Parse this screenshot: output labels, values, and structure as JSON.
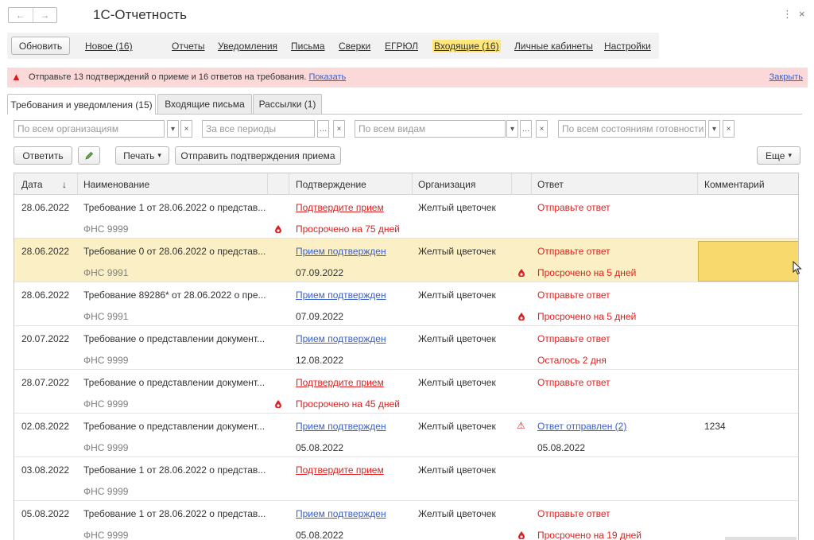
{
  "window": {
    "title": "1С-Отчетность",
    "nav_back": "←",
    "nav_forward": "→",
    "menu_glyph": "⋮",
    "close_glyph": "×"
  },
  "commandbar": {
    "refresh": "Обновить",
    "links": [
      "Новое (16)",
      "Отчеты",
      "Уведомления",
      "Письма",
      "Сверки",
      "ЕГРЮЛ",
      "Входящие (16)",
      "Личные кабинеты",
      "Настройки"
    ],
    "active_link": "Входящие (16)"
  },
  "alert": {
    "icon": "warning-icon",
    "text": "Отправьте 13 подтверждений о приеме и 16 ответов на требования.",
    "link": "Показать",
    "close": "Закрыть",
    "color": "#fbd9d9"
  },
  "tabs": [
    "Требования и уведомления (15)",
    "Входящие письма",
    "Рассылки (1)"
  ],
  "filters": {
    "org_placeholder": "По всем организациям",
    "period_placeholder": "За все периоды",
    "kind_placeholder": "По всем видам",
    "state_placeholder": "По всем состояниям готовности"
  },
  "toolbar": {
    "reply": "Ответить",
    "print": "Печать",
    "send_confirmations": "Отправить подтверждения приема",
    "more": "Еще"
  },
  "table": {
    "columns": [
      "Дата",
      "Наименование",
      "Подтверждение",
      "Организация",
      "Ответ",
      "Комментарий"
    ],
    "sort_glyph": "↓",
    "rows": [
      {
        "date": "28.06.2022",
        "name": "Требование 1 от 28.06.2022 о представ...",
        "sender": "ФНС 9999",
        "confirm": "Подтвердите прием",
        "confirm_style": "linkred",
        "confirm_status": "Просрочено на 75 дней",
        "confirm_status_style": "red",
        "org": "Желтый цветочек",
        "answer": "Отправьте ответ",
        "answer_style": "red",
        "answer_status": "",
        "answer_status_style": "",
        "comment": "",
        "selected": false,
        "confirm_icon": "drop-icon",
        "answer_icon": ""
      },
      {
        "date": "28.06.2022",
        "name": "Требование 0 от 28.06.2022 о представ...",
        "sender": "ФНС 9991",
        "confirm": "Прием подтвержден",
        "confirm_style": "link",
        "confirm_status": "07.09.2022",
        "confirm_status_style": "",
        "org": "Желтый цветочек",
        "answer": "Отправьте ответ",
        "answer_style": "red",
        "answer_status": "Просрочено на 5 дней",
        "answer_status_style": "red",
        "comment": "",
        "selected": true,
        "confirm_icon": "",
        "answer_icon": "drop-icon"
      },
      {
        "date": "28.06.2022",
        "name": "Требование 89286* от 28.06.2022 о пре...",
        "sender": "ФНС 9991",
        "confirm": "Прием подтвержден",
        "confirm_style": "link",
        "confirm_status": "07.09.2022",
        "confirm_status_style": "",
        "org": "Желтый цветочек",
        "answer": "Отправьте ответ",
        "answer_style": "red",
        "answer_status": "Просрочено на 5 дней",
        "answer_status_style": "red",
        "comment": "",
        "selected": false,
        "confirm_icon": "",
        "answer_icon": "drop-icon"
      },
      {
        "date": "20.07.2022",
        "name": "Требование о представлении документ...",
        "sender": "ФНС 9999",
        "confirm": "Прием подтвержден",
        "confirm_style": "link",
        "confirm_status": "12.08.2022",
        "confirm_status_style": "",
        "org": "Желтый цветочек",
        "answer": "Отправьте ответ",
        "answer_style": "red",
        "answer_status": "Осталось 2 дня",
        "answer_status_style": "red",
        "comment": "",
        "selected": false,
        "confirm_icon": "",
        "answer_icon": ""
      },
      {
        "date": "28.07.2022",
        "name": "Требование о представлении документ...",
        "sender": "ФНС 9999",
        "confirm": "Подтвердите прием",
        "confirm_style": "linkred",
        "confirm_status": "Просрочено на 45 дней",
        "confirm_status_style": "red",
        "org": "Желтый цветочек",
        "answer": "Отправьте ответ",
        "answer_style": "red",
        "answer_status": "",
        "answer_status_style": "",
        "comment": "",
        "selected": false,
        "confirm_icon": "drop-icon",
        "answer_icon": ""
      },
      {
        "date": "02.08.2022",
        "name": "Требование о представлении документ...",
        "sender": "ФНС 9999",
        "confirm": "Прием подтвержден",
        "confirm_style": "link",
        "confirm_status": "05.08.2022",
        "confirm_status_style": "",
        "org": "Желтый цветочек",
        "answer": "Ответ отправлен (2)",
        "answer_style": "link",
        "answer_status": "05.08.2022",
        "answer_status_style": "",
        "comment": "1234",
        "selected": false,
        "confirm_icon": "",
        "answer_icon": "warning-icon"
      },
      {
        "date": "03.08.2022",
        "name": "Требование 1 от 28.06.2022 о представ...",
        "sender": "ФНС 9999",
        "confirm": "Подтвердите прием",
        "confirm_style": "linkred",
        "confirm_status": "",
        "confirm_status_style": "",
        "org": "Желтый цветочек",
        "answer": "",
        "answer_style": "",
        "answer_status": "",
        "answer_status_style": "",
        "comment": "",
        "selected": false,
        "confirm_icon": "",
        "answer_icon": ""
      },
      {
        "date": "05.08.2022",
        "name": "Требование 1 от 28.06.2022 о представ...",
        "sender": "ФНС 9999",
        "confirm": "Прием подтвержден",
        "confirm_style": "link",
        "confirm_status": "05.08.2022",
        "confirm_status_style": "",
        "org": "Желтый цветочек",
        "answer": "Отправьте ответ",
        "answer_style": "red",
        "answer_status": "Просрочено на 19 дней",
        "answer_status_style": "red",
        "comment": "",
        "selected": false,
        "confirm_icon": "",
        "answer_icon": "drop-icon"
      }
    ]
  }
}
